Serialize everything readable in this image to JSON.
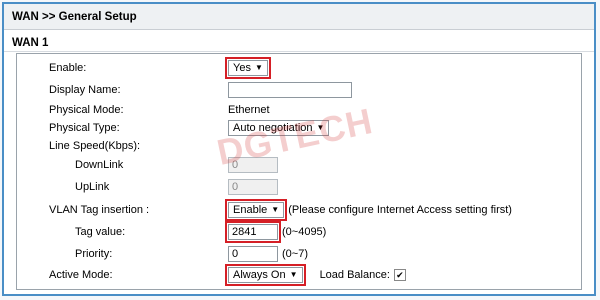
{
  "header": {
    "title": "WAN >> General Setup"
  },
  "section": {
    "title": "WAN 1"
  },
  "form": {
    "enable": {
      "label": "Enable:",
      "value": "Yes"
    },
    "display_name": {
      "label": "Display Name:",
      "value": ""
    },
    "physical_mode": {
      "label": "Physical Mode:",
      "value": "Ethernet"
    },
    "physical_type": {
      "label": "Physical Type:",
      "value": "Auto negotiation"
    },
    "line_speed": {
      "label": "Line Speed(Kbps):"
    },
    "downlink": {
      "label": "DownLink",
      "value": "0"
    },
    "uplink": {
      "label": "UpLink",
      "value": "0"
    },
    "vlan": {
      "label": "VLAN Tag insertion :",
      "value": "Enable",
      "note": "(Please configure Internet Access setting first)"
    },
    "tag_value": {
      "label": "Tag value:",
      "value": "2841",
      "range": "(0~4095)"
    },
    "priority": {
      "label": "Priority:",
      "value": "0",
      "range": "(0~7)"
    },
    "active_mode": {
      "label": "Active Mode:",
      "value": "Always On"
    },
    "load_balance": {
      "label": "Load Balance:",
      "checked": true,
      "check_glyph": "✔"
    }
  },
  "watermark": {
    "text": "DGTECH"
  },
  "colors": {
    "frame": "#4a8ec6",
    "highlight": "#d51f26"
  }
}
